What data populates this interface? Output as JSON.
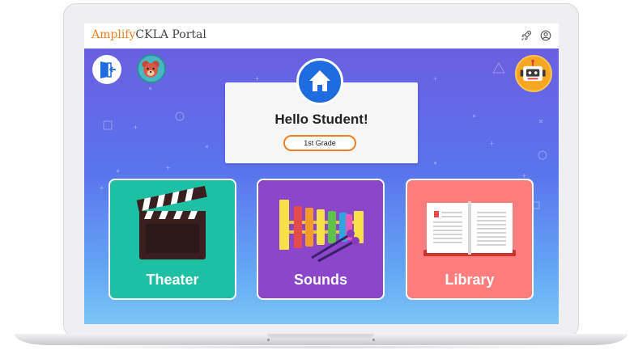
{
  "browser": {
    "brand_prefix": "Amplify",
    "brand_suffix": "CKLA Portal",
    "icons": [
      "rocket-icon",
      "user-circle-icon"
    ]
  },
  "header": {
    "greeting": "Hello Student!",
    "grade": "1st Grade",
    "icons": [
      "exit-icon",
      "student-avatar",
      "home-icon",
      "robot-icon"
    ]
  },
  "tiles": [
    {
      "label": "Theater",
      "icon": "clapperboard-icon",
      "color": "#1ec0a4"
    },
    {
      "label": "Sounds",
      "icon": "xylophone-icon",
      "color": "#8c46c9"
    },
    {
      "label": "Library",
      "icon": "open-book-icon",
      "color": "#ff7d7d"
    }
  ],
  "colors": {
    "brand_orange": "#f0801d",
    "home_blue": "#1f6be0",
    "background_top": "#6a5fe0",
    "background_bottom": "#7cc4f6"
  }
}
